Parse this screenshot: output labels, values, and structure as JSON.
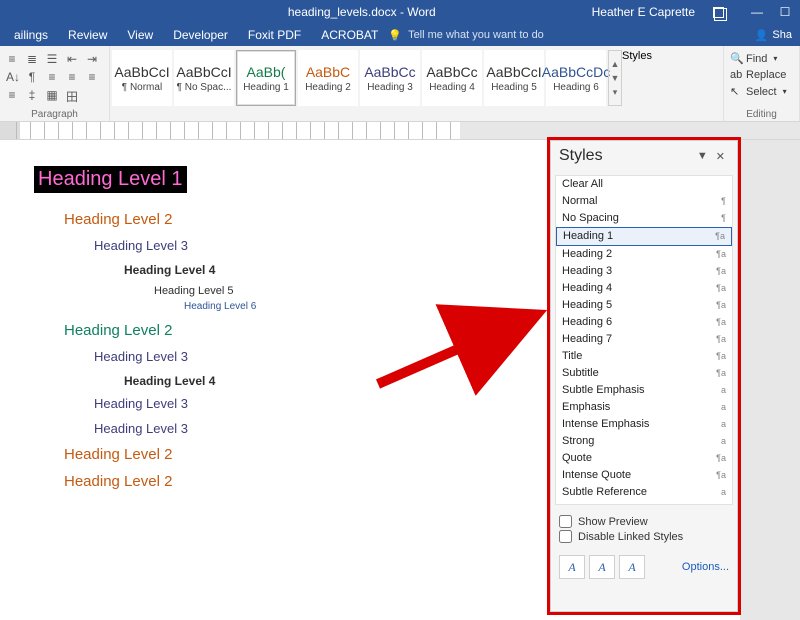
{
  "titlebar": {
    "title": "heading_levels.docx - Word",
    "user": "Heather E Caprette"
  },
  "tabs": {
    "items": [
      "ailings",
      "Review",
      "View",
      "Developer",
      "Foxit PDF",
      "ACROBAT"
    ],
    "tell": "Tell me what you want to do",
    "share": "Sha"
  },
  "ribbon": {
    "paragraph_label": "Paragraph",
    "styles_label": "Styles",
    "editing_label": "Editing",
    "gallery": [
      {
        "sample": "AaBbCcI",
        "caption": "¶ Normal",
        "color": "#333"
      },
      {
        "sample": "AaBbCcI",
        "caption": "¶ No Spac...",
        "color": "#333"
      },
      {
        "sample": "AaBb(",
        "caption": "Heading 1",
        "color": "#147a4a",
        "sel": true
      },
      {
        "sample": "AaBbC",
        "caption": "Heading 2",
        "color": "#c55a11"
      },
      {
        "sample": "AaBbCc",
        "caption": "Heading 3",
        "color": "#3d3d7c"
      },
      {
        "sample": "AaBbCc",
        "caption": "Heading 4",
        "color": "#333"
      },
      {
        "sample": "AaBbCcI",
        "caption": "Heading 5",
        "color": "#333"
      },
      {
        "sample": "AaBbCcDc",
        "caption": "Heading 6",
        "color": "#2f5496"
      }
    ],
    "editing": {
      "find": "Find",
      "replace": "Replace",
      "select": "Select"
    }
  },
  "document": {
    "h1": "Heading Level 1",
    "h2a": "Heading Level 2",
    "h3a": "Heading Level 3",
    "h4a": "Heading Level 4",
    "h5": "Heading Level 5",
    "h6": "Heading Level 6",
    "h2b": "Heading Level 2",
    "h3b": "Heading Level 3",
    "h4b": "Heading Level 4",
    "h3c": "Heading Level 3",
    "h3d": "Heading Level 3",
    "h2c": "Heading Level 2",
    "h2d": "Heading Level 2"
  },
  "pane": {
    "title": "Styles",
    "items": [
      {
        "name": "Clear All",
        "ind": ""
      },
      {
        "name": "Normal",
        "ind": "¶"
      },
      {
        "name": "No Spacing",
        "ind": "¶"
      },
      {
        "name": "Heading 1",
        "ind": "¶a",
        "sel": true
      },
      {
        "name": "Heading 2",
        "ind": "¶a"
      },
      {
        "name": "Heading 3",
        "ind": "¶a"
      },
      {
        "name": "Heading 4",
        "ind": "¶a"
      },
      {
        "name": "Heading 5",
        "ind": "¶a"
      },
      {
        "name": "Heading 6",
        "ind": "¶a"
      },
      {
        "name": "Heading 7",
        "ind": "¶a"
      },
      {
        "name": "Title",
        "ind": "¶a"
      },
      {
        "name": "Subtitle",
        "ind": "¶a"
      },
      {
        "name": "Subtle Emphasis",
        "ind": "a"
      },
      {
        "name": "Emphasis",
        "ind": "a"
      },
      {
        "name": "Intense Emphasis",
        "ind": "a"
      },
      {
        "name": "Strong",
        "ind": "a"
      },
      {
        "name": "Quote",
        "ind": "¶a"
      },
      {
        "name": "Intense Quote",
        "ind": "¶a"
      },
      {
        "name": "Subtle Reference",
        "ind": "a"
      }
    ],
    "show_preview": "Show Preview",
    "disable_linked": "Disable Linked Styles",
    "options": "Options..."
  }
}
